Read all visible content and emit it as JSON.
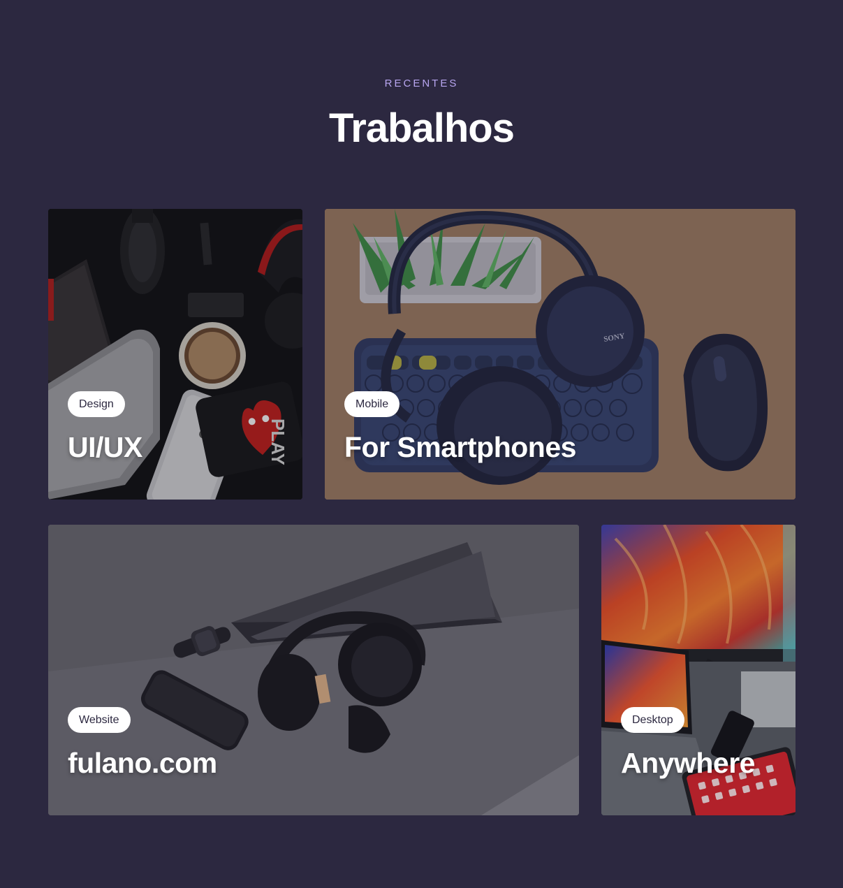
{
  "section": {
    "eyebrow": "RECENTES",
    "title": "Trabalhos"
  },
  "cards": [
    {
      "tag": "Design",
      "title": "UI/UX",
      "image": "desk-flatlay-phone-coffee-image"
    },
    {
      "tag": "Mobile",
      "title": "For Smartphones",
      "image": "headphones-keyboard-mouse-image"
    },
    {
      "tag": "Website",
      "title": "fulano.com",
      "image": "laptop-headphones-watch-image"
    },
    {
      "tag": "Desktop",
      "title": "Anywhere",
      "image": "monitor-laptop-colorful-wallpaper-image"
    }
  ],
  "colors": {
    "background": "#2c2840",
    "accent": "#b8a6f0",
    "tag_text": "#2c2840",
    "tag_bg": "#ffffff"
  }
}
